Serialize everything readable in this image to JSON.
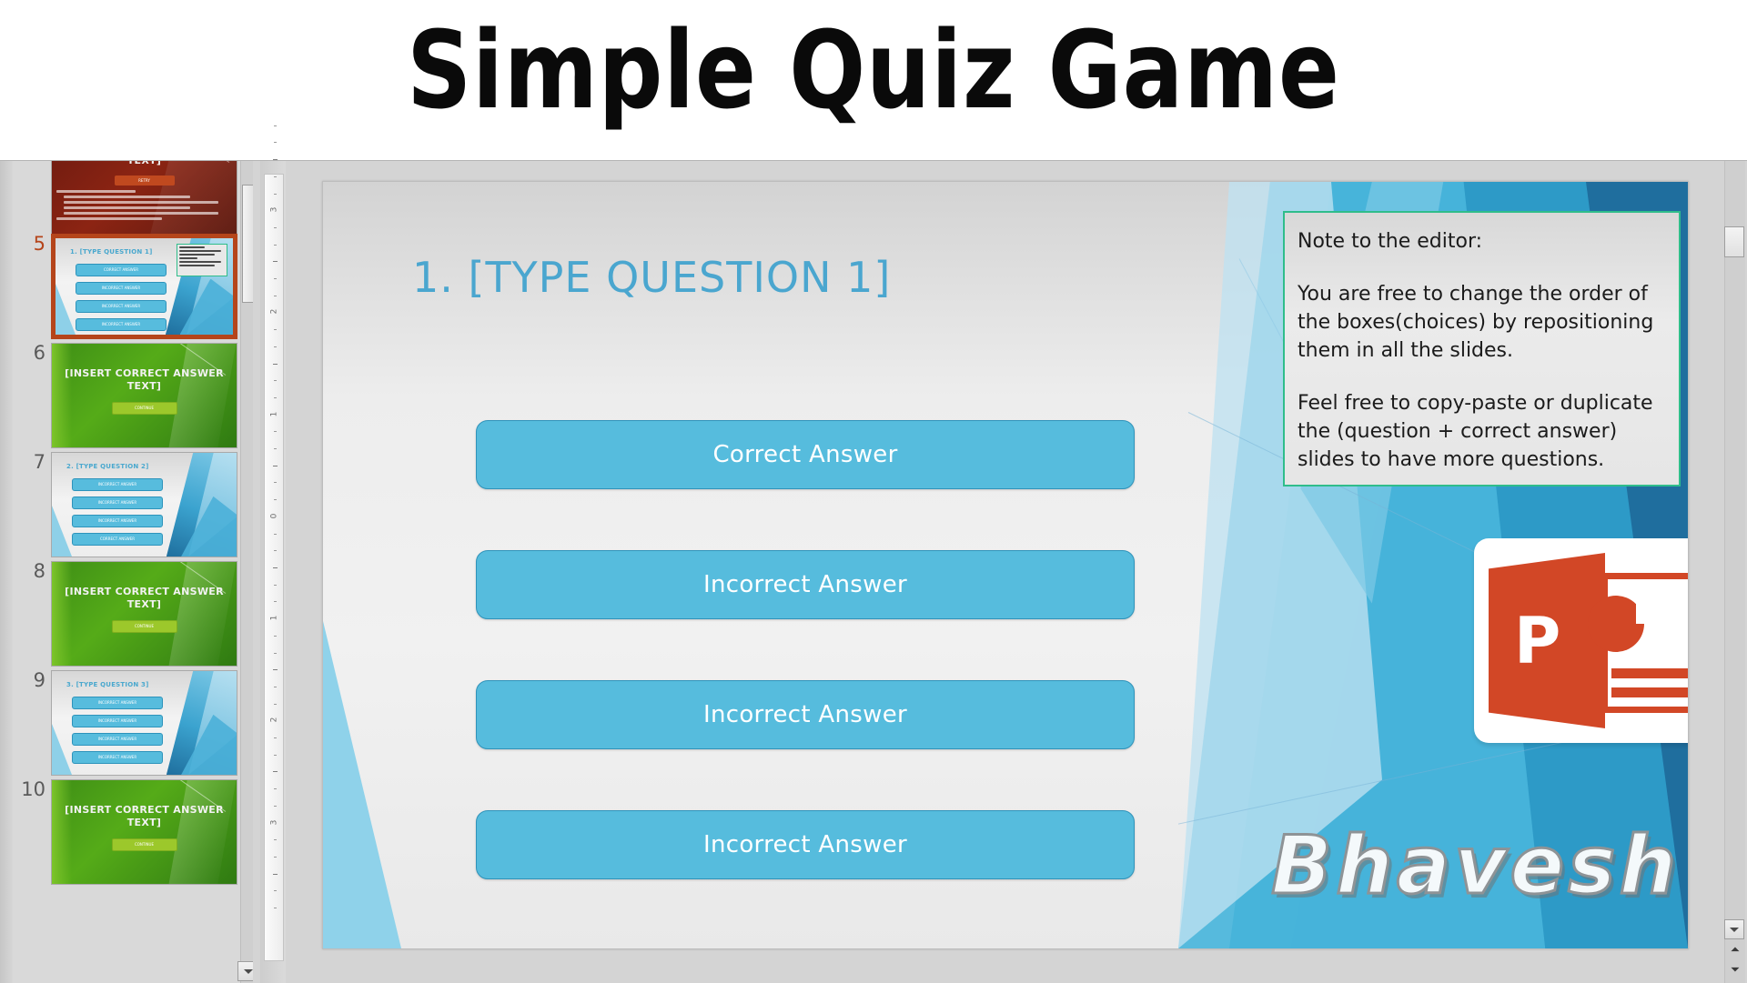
{
  "banner": {
    "title": "Simple Quiz Game"
  },
  "thumbnail_panel": {
    "slides": [
      {
        "number": "",
        "type": "wrong-answer",
        "title": "[INSERT WRONG ANSWER TEXT]",
        "button_label": "RETRY",
        "selected": false
      },
      {
        "number": "5",
        "type": "question",
        "title": "1. [TYPE QUESTION 1]",
        "buttons": [
          "CORRECT ANSWER",
          "INCORRECT ANSWER",
          "INCORRECT ANSWER",
          "INCORRECT ANSWER"
        ],
        "selected": true
      },
      {
        "number": "6",
        "type": "correct-answer",
        "title": "[INSERT CORRECT ANSWER TEXT]",
        "button_label": "CONTINUE",
        "selected": false
      },
      {
        "number": "7",
        "type": "question",
        "title": "2. [TYPE QUESTION 2]",
        "buttons": [
          "INCORRECT ANSWER",
          "INCORRECT ANSWER",
          "INCORRECT ANSWER",
          "CORRECT ANSWER"
        ],
        "selected": false
      },
      {
        "number": "8",
        "type": "correct-answer",
        "title": "[INSERT CORRECT ANSWER TEXT]",
        "button_label": "CONTINUE",
        "selected": false
      },
      {
        "number": "9",
        "type": "question",
        "title": "3. [TYPE QUESTION 3]",
        "buttons": [
          "INCORRECT ANSWER",
          "INCORRECT ANSWER",
          "INCORRECT ANSWER",
          "INCORRECT ANSWER"
        ],
        "selected": false
      },
      {
        "number": "10",
        "type": "correct-answer",
        "title": "[INSERT CORRECT ANSWER TEXT]",
        "button_label": "CONTINUE",
        "selected": false
      }
    ]
  },
  "ruler": {
    "labels": [
      "3",
      "2",
      "1",
      "0",
      "1",
      "2",
      "3"
    ]
  },
  "slide": {
    "question_title": "1.  [TYPE QUESTION 1]",
    "answers": [
      {
        "label": "Correct Answer"
      },
      {
        "label": "Incorrect Answer"
      },
      {
        "label": "Incorrect Answer"
      },
      {
        "label": "Incorrect Answer"
      }
    ],
    "note": {
      "heading": "Note to the editor:",
      "paragraph1": "You are free to change the order of the boxes(choices) by repositioning them in all the slides.",
      "paragraph2": "Feel free to copy-paste or duplicate the (question + correct answer) slides to have more questions."
    },
    "logo": {
      "letter": "P"
    },
    "watermark": "Bhavesh Shaha"
  },
  "colors": {
    "answer_button": "#56bcdd",
    "answer_button_border": "#2f93ba",
    "question_title": "#4aa6cf",
    "note_border": "#2fbd8b",
    "selection_border": "#b5451b",
    "powerpoint_red": "#d24726"
  }
}
